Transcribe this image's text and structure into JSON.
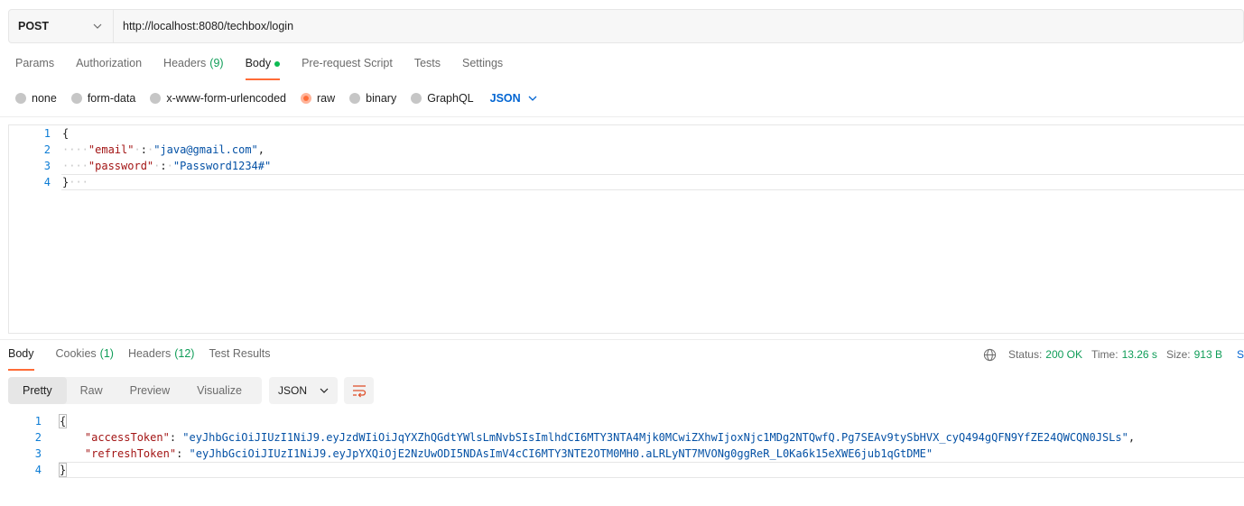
{
  "request": {
    "method": "POST",
    "url": "http://localhost:8080/techbox/login"
  },
  "request_tabs": [
    {
      "label": "Params"
    },
    {
      "label": "Authorization"
    },
    {
      "label": "Headers",
      "count": "(9)"
    },
    {
      "label": "Body",
      "active": true
    },
    {
      "label": "Pre-request Script"
    },
    {
      "label": "Tests"
    },
    {
      "label": "Settings"
    }
  ],
  "body_types": {
    "options": [
      "none",
      "form-data",
      "x-www-form-urlencoded",
      "raw",
      "binary",
      "GraphQL"
    ],
    "selected": "raw",
    "language": "JSON"
  },
  "request_body": {
    "line_numbers": [
      "1",
      "2",
      "3",
      "4"
    ],
    "open_brace": "{",
    "close_brace": "}",
    "email_key": "\"email\"",
    "email_value": "\"java@gmail.com\"",
    "password_key": "\"password\"",
    "password_value": "\"Password1234#\""
  },
  "response_tabs": [
    {
      "label": "Body",
      "active": true
    },
    {
      "label": "Cookies",
      "count": "(1)"
    },
    {
      "label": "Headers",
      "count": "(12)"
    },
    {
      "label": "Test Results"
    }
  ],
  "response_meta": {
    "status_label": "Status:",
    "status_value": "200 OK",
    "time_label": "Time:",
    "time_value": "13.26 s",
    "size_label": "Size:",
    "size_value": "913 B",
    "save_label": "S"
  },
  "view_tabs": [
    "Pretty",
    "Raw",
    "Preview",
    "Visualize"
  ],
  "view_format": "JSON",
  "response_body": {
    "line_numbers": [
      "1",
      "2",
      "3",
      "4"
    ],
    "open_brace": "{",
    "close_brace": "}",
    "access_key": "\"accessToken\"",
    "access_value": "\"eyJhbGciOiJIUzI1NiJ9.eyJzdWIiOiJqYXZhQGdtYWlsLmNvbSIsImlhdCI6MTY3NTA4Mjk0MCwiZXhwIjoxNjc1MDg2NTQwfQ.Pg7SEAv9tySbHVX_cyQ494gQFN9YfZE24QWCQN0JSLs\"",
    "refresh_key": "\"refreshToken\"",
    "refresh_value": "\"eyJhbGciOiJIUzI1NiJ9.eyJpYXQiOjE2NzUwODI5NDAsImV4cCI6MTY3NTE2OTM0MH0.aLRLyNT7MVONg0ggReR_L0Ka6k15eXWE6jub1qGtDME\""
  },
  "colors": {
    "accent": "#ff6c37",
    "status_ok": "#0f9d58",
    "link_blue": "#0265d2",
    "json_key": "#a31515",
    "json_string": "#0451a5"
  },
  "icons": {
    "method_dropdown": "chevron-down-icon",
    "language_dropdown": "chevron-down-icon",
    "network": "globe-icon",
    "wrap": "wrap-lines-icon"
  }
}
